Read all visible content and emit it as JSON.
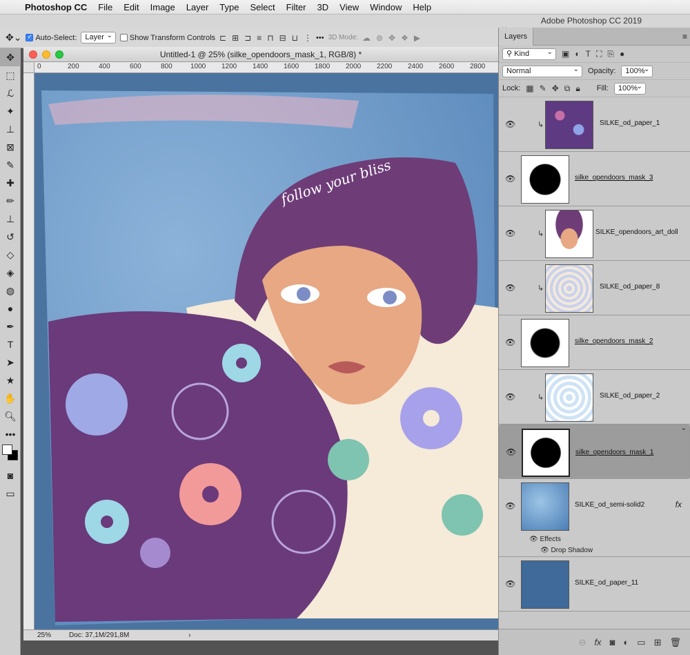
{
  "menubar": {
    "app_name": "Photoshop CC",
    "items": [
      "File",
      "Edit",
      "Image",
      "Layer",
      "Type",
      "Select",
      "Filter",
      "3D",
      "View",
      "Window",
      "Help"
    ]
  },
  "app_title": "Adobe Photoshop CC 2019",
  "options": {
    "auto_select_label": "Auto-Select:",
    "auto_select_value": "Layer",
    "transform_label": "Show Transform Controls",
    "mode_3d_label": "3D Mode:"
  },
  "document": {
    "title": "Untitled-1 @ 25% (silke_opendoors_mask_1, RGB/8) *",
    "ruler_h": [
      "0",
      "200",
      "400",
      "600",
      "800",
      "1000",
      "1200",
      "1400",
      "1600",
      "1800",
      "2000",
      "2200",
      "2400",
      "2600",
      "2800"
    ],
    "canvas_text": "follow your bliss",
    "zoom": "25%",
    "doc_info": "Doc: 37,1M/291,8M"
  },
  "layers_panel": {
    "tab": "Layers",
    "filter_kind": "Kind",
    "blend_mode": "Normal",
    "opacity_label": "Opacity:",
    "opacity_value": "100%",
    "lock_label": "Lock:",
    "fill_label": "Fill:",
    "fill_value": "100%",
    "layers": [
      {
        "name": "SILKE_od_paper_1",
        "clipped": true,
        "underline": false
      },
      {
        "name": "silke_opendoors_mask_3",
        "clipped": false,
        "underline": true
      },
      {
        "name": "SILKE_opendoors_art_doll",
        "clipped": true,
        "underline": false
      },
      {
        "name": "SILKE_od_paper_8",
        "clipped": true,
        "underline": false
      },
      {
        "name": "silke_opendoors_mask_2",
        "clipped": false,
        "underline": true
      },
      {
        "name": "SILKE_od_paper_2",
        "clipped": true,
        "underline": false
      },
      {
        "name": "silke_opendoors_mask_1",
        "clipped": false,
        "underline": true,
        "selected": true
      },
      {
        "name": "SILKE_od_semi-solid2",
        "clipped": false,
        "underline": false,
        "fx": "fx"
      },
      {
        "name": "SILKE_od_paper_11",
        "clipped": false,
        "underline": false
      }
    ],
    "effects_label": "Effects",
    "drop_shadow_label": "Drop Shadow"
  }
}
